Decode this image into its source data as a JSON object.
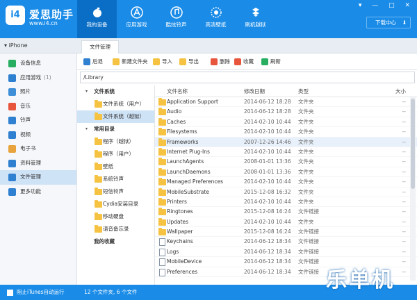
{
  "app": {
    "name": "爱思助手",
    "url": "www.i4.cn",
    "logo_text": "i4"
  },
  "nav_tabs": [
    {
      "label": "我的设备",
      "icon": "apple-icon",
      "active": true
    },
    {
      "label": "应用游戏",
      "icon": "app-store-icon",
      "active": false
    },
    {
      "label": "酷炫铃声",
      "icon": "music-note-icon",
      "active": false
    },
    {
      "label": "高清壁纸",
      "icon": "flower-icon",
      "active": false
    },
    {
      "label": "刷机越狱",
      "icon": "dropbox-icon",
      "active": false
    }
  ],
  "window_controls": {
    "text": "▾ — □ ✕"
  },
  "download_center": {
    "label": "下载中心",
    "arrow": "⬇"
  },
  "device": {
    "name": "iPhone",
    "caret": "▾"
  },
  "content_tab": {
    "label": "文件管理"
  },
  "sidebar": {
    "items": [
      {
        "label": "设备信息",
        "icon": "info-icon",
        "color": "#27ae60"
      },
      {
        "label": "应用游戏",
        "count": "(1)",
        "icon": "apps-icon",
        "color": "#2f80d1"
      },
      {
        "label": "照片",
        "icon": "photo-icon",
        "color": "#3f8fd8"
      },
      {
        "label": "音乐",
        "icon": "music-icon",
        "color": "#e8553d"
      },
      {
        "label": "铃声",
        "icon": "bell-icon",
        "color": "#2f80d1"
      },
      {
        "label": "视频",
        "icon": "video-icon",
        "color": "#2f80d1"
      },
      {
        "label": "电子书",
        "icon": "book-icon",
        "color": "#e8a33d"
      },
      {
        "label": "资料管理",
        "icon": "contacts-icon",
        "color": "#2f80d1"
      },
      {
        "label": "文件管理",
        "icon": "files-icon",
        "color": "#2f80d1",
        "active": true
      },
      {
        "label": "更多功能",
        "icon": "grid-icon",
        "color": "#2f80d1"
      }
    ]
  },
  "toolbar": {
    "buttons": [
      {
        "label": "后退",
        "icon": "back-icon",
        "color": "#2f80d1"
      },
      {
        "label": "新建文件夹",
        "icon": "new-folder-icon",
        "color": "#f5c242"
      },
      {
        "label": "导入",
        "icon": "import-icon",
        "color": "#f5c242"
      },
      {
        "label": "导出",
        "icon": "export-icon",
        "color": "#f5c242"
      },
      {
        "label": "删除",
        "icon": "delete-icon",
        "color": "#e8553d"
      },
      {
        "label": "收藏",
        "icon": "favorite-icon",
        "color": "#e8553d"
      },
      {
        "label": "刷新",
        "icon": "refresh-icon",
        "color": "#27ae60"
      }
    ]
  },
  "path": "/Library",
  "tree": {
    "sections": [
      {
        "title": "文件系统",
        "children": [
          "文件系统（用户）",
          "文件系统（越狱）"
        ]
      },
      {
        "title": "常用目录",
        "children": [
          "程序（越狱）",
          "程序（用户）",
          "壁纸",
          "系统铃声",
          "短信铃声",
          "Cydia安装目录",
          "移动硬盘",
          "语音备忘录"
        ]
      }
    ],
    "favorites": "我的收藏",
    "caret": "▾",
    "selected": "文件系统（越狱）"
  },
  "file_list": {
    "columns": {
      "name": "文件名称",
      "date": "修改日期",
      "type": "类型",
      "size": "大小"
    },
    "rows": [
      {
        "name": "Application Support",
        "date": "2014-06-12 18:28",
        "type": "文件夹",
        "size": "--",
        "kind": "folder"
      },
      {
        "name": "Audio",
        "date": "2014-06-12 18:28",
        "type": "文件夹",
        "size": "--",
        "kind": "folder"
      },
      {
        "name": "Caches",
        "date": "2014-02-10 10:44",
        "type": "文件夹",
        "size": "--",
        "kind": "folder"
      },
      {
        "name": "Filesystems",
        "date": "2014-02-10 10:44",
        "type": "文件夹",
        "size": "--",
        "kind": "folder"
      },
      {
        "name": "Frameworks",
        "date": "2007-12-26 14:46",
        "type": "文件夹",
        "size": "--",
        "kind": "folder",
        "selected": true
      },
      {
        "name": "Internet Plug-Ins",
        "date": "2014-02-10 10:44",
        "type": "文件夹",
        "size": "--",
        "kind": "folder"
      },
      {
        "name": "LaunchAgents",
        "date": "2008-01-01 13:36",
        "type": "文件夹",
        "size": "--",
        "kind": "folder"
      },
      {
        "name": "LaunchDaemons",
        "date": "2008-01-01 13:36",
        "type": "文件夹",
        "size": "--",
        "kind": "folder"
      },
      {
        "name": "Managed Preferences",
        "date": "2014-02-10 10:44",
        "type": "文件夹",
        "size": "--",
        "kind": "folder"
      },
      {
        "name": "MobileSubstrate",
        "date": "2015-12-08 16:32",
        "type": "文件夹",
        "size": "--",
        "kind": "folder"
      },
      {
        "name": "Printers",
        "date": "2014-02-10 10:44",
        "type": "文件夹",
        "size": "--",
        "kind": "folder"
      },
      {
        "name": "Ringtones",
        "date": "2015-12-08 16:24",
        "type": "文件链接",
        "size": "--",
        "kind": "folder"
      },
      {
        "name": "Updates",
        "date": "2014-02-10 10:44",
        "type": "文件夹",
        "size": "--",
        "kind": "folder"
      },
      {
        "name": "Wallpaper",
        "date": "2015-12-08 16:24",
        "type": "文件链接",
        "size": "--",
        "kind": "folder"
      },
      {
        "name": "Keychains",
        "date": "2014-06-12 18:34",
        "type": "文件链接",
        "size": "--",
        "kind": "file"
      },
      {
        "name": "Logs",
        "date": "2014-06-12 18:34",
        "type": "文件链接",
        "size": "--",
        "kind": "file"
      },
      {
        "name": "MobileDevice",
        "date": "2014-06-12 18:34",
        "type": "文件链接",
        "size": "--",
        "kind": "file"
      },
      {
        "name": "Preferences",
        "date": "2014-06-12 18:34",
        "type": "文件链接",
        "size": "--",
        "kind": "file"
      }
    ]
  },
  "status": {
    "itunes_label": "阻止iTunes自动运行",
    "count": "12 个文件夹, 6 个文件"
  },
  "watermark": "乐单机",
  "colors": {
    "accent": "#1a8ce8",
    "accent_dark": "#0a6ec7",
    "selection": "#cfe3f7",
    "folder": "#f5c242"
  }
}
